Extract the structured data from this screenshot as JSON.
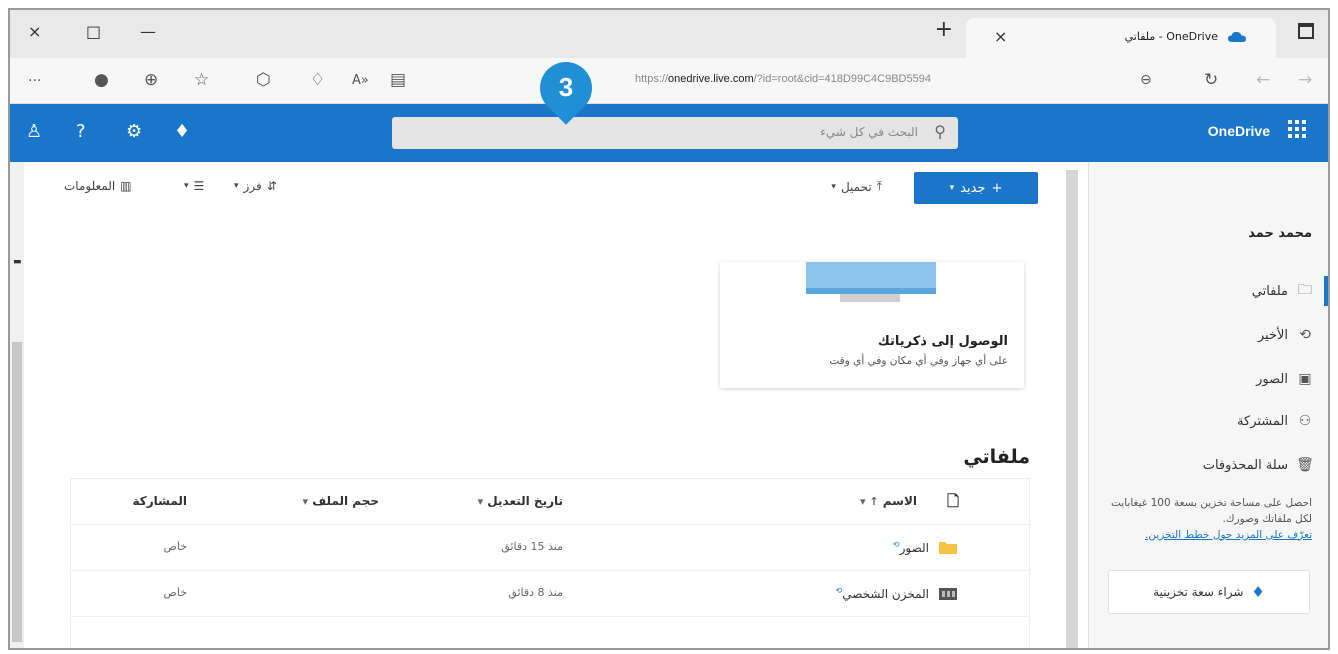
{
  "browser": {
    "tab_title": "OneDrive - ملفاتي",
    "url_prefix": "https://",
    "url_domain": "onedrive.live.com",
    "url_rest": "/?id=root&cid=418D99C4C9BD5594",
    "tab_close": "×",
    "tab_new": "+",
    "window_close": "×",
    "window_restore": "□",
    "window_minimize": "—",
    "more_icon": "···"
  },
  "marker": {
    "label": "3"
  },
  "header": {
    "brand": "OneDrive",
    "search_placeholder": "البحث في كل شيء",
    "help": "?"
  },
  "nav": {
    "user_name": "محمد حمد",
    "items": [
      {
        "label": "ملفاتي",
        "icon": "folder-icon",
        "glyph": "🗀"
      },
      {
        "label": "الأخير",
        "icon": "history-icon",
        "glyph": "⟲"
      },
      {
        "label": "الصور",
        "icon": "photos-icon",
        "glyph": "▣"
      },
      {
        "label": "المشتركة",
        "icon": "shared-icon",
        "glyph": "⚇"
      },
      {
        "label": "سلة المحذوفات",
        "icon": "trash-icon",
        "glyph": "🗑"
      }
    ],
    "promo_text": "احصل على مساحة تخزين بسعة 100 غيغابايت لكل ملفاتك وصورك.",
    "promo_link": "تعرّف على المزيد حول خطط التخزين.",
    "buy_label": "شراء سعة تخزينية"
  },
  "commands": {
    "new_label": "جديد",
    "upload_label": "تحميل",
    "sort_label": "فرز",
    "info_label": "المعلومات"
  },
  "card": {
    "title": "الوصول إلى ذكرياتك",
    "subtitle": "على أي جهاز وفي أي مكان وفي أي وقت"
  },
  "section": {
    "title": "ملفاتي"
  },
  "table": {
    "columns": {
      "name": "الاسم",
      "modified": "تاريخ التعديل",
      "size": "حجم الملف",
      "sharing": "المشاركة"
    },
    "rows": [
      {
        "name": "الصور",
        "modified": "منذ 15 دقائق",
        "sharing": "خاص",
        "type": "folder"
      },
      {
        "name": "المخزن الشخصي",
        "modified": "منذ 8 دقائق",
        "sharing": "خاص",
        "type": "vault"
      }
    ]
  },
  "colors": {
    "brand_blue": "#1976c8",
    "marker_blue": "#1f8fd6",
    "folder_yellow": "#f5c542"
  }
}
